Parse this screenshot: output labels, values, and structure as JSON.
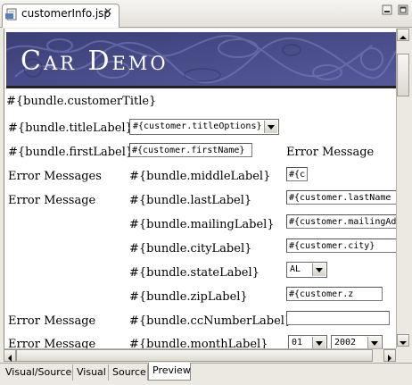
{
  "editor": {
    "tab_title": "customerInfo.jsp",
    "tab_close": "✕",
    "icons": {
      "file": "jsp-file-icon",
      "minimize": "minimize-icon",
      "maximize": "maximize-icon"
    }
  },
  "banner": {
    "title": "Car Demo"
  },
  "form": {
    "customer_title": "#{bundle.customerTitle}",
    "title_label": "#{bundle.titleLabel}",
    "title_select": "#{customer.titleOptions}",
    "first_label": "#{bundle.firstLabel}",
    "first_value": "#{customer.firstName}",
    "first_error": "Error Message",
    "middle_error": "Error Messages",
    "middle_label": "#{bundle.middleLabel}",
    "middle_value": "#{c",
    "last_error": "Error Message",
    "last_label": "#{bundle.lastLabel}",
    "last_value": "#{customer.lastName",
    "mailing_label": "#{bundle.mailingLabel}",
    "mailing_value": "#{customer.mailingAd",
    "city_label": "#{bundle.cityLabel}",
    "city_value": "#{customer.city}",
    "state_label": "#{bundle.stateLabel}",
    "state_value": "AL",
    "zip_label": "#{bundle.zipLabel}",
    "zip_value": "#{customer.z",
    "cc_error": "Error Message",
    "cc_label": "#{bundle.ccNumberLabel}",
    "cc_value": "",
    "month_error": "Error Message",
    "month_label": "#{bundle.monthLabel}",
    "month_value": "01",
    "year_value": "2002"
  },
  "bottom_tabs": [
    {
      "label": "Visual/Source"
    },
    {
      "label": "Visual"
    },
    {
      "label": "Source"
    },
    {
      "label": "Preview"
    }
  ],
  "colors": {
    "banner_base": "#4a4f8c",
    "banner_swirl": "#6a6fb0",
    "selected_tab": "#ffffff"
  }
}
